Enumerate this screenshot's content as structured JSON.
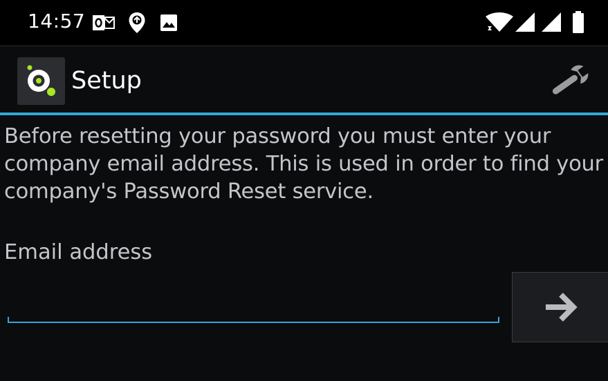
{
  "status_bar": {
    "time": "14:57",
    "icons": [
      "outlook-icon",
      "location-icon",
      "image-icon",
      "wifi-icon",
      "signal-icon",
      "signal-icon",
      "battery-icon"
    ]
  },
  "action_bar": {
    "title": "Setup",
    "icons": [
      "app-logo-icon",
      "wrench-icon"
    ]
  },
  "main": {
    "instructions": "Before resetting your password you must enter your company email address. This is used in order to find your company's Password Reset service.",
    "email_label": "Email address",
    "email_value": "",
    "submit_icon": "arrow-right-icon"
  },
  "colors": {
    "accent": "#33a7d8",
    "background": "#0b0c0e",
    "status_bar": "#000000",
    "logo_green": "#a7e628"
  }
}
